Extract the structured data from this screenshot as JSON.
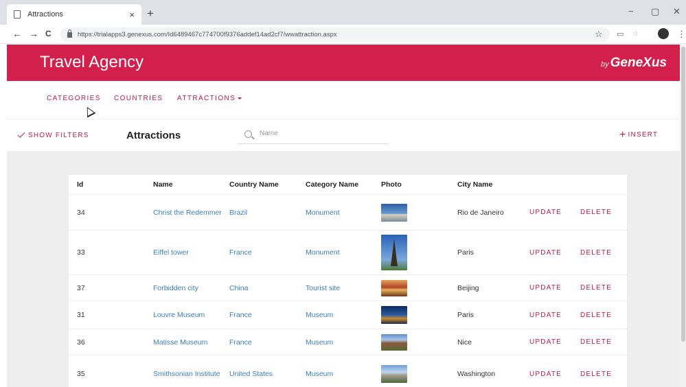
{
  "browser": {
    "tab_title": "Attractions",
    "tab_close": "×",
    "new_tab": "+",
    "back": "←",
    "forward": "→",
    "reload": "C",
    "url": "https://trialapps3.genexus.com/Id6489467c774700f9376addef14ad2cf7/wwattraction.aspx",
    "star": "☆",
    "minimize": "−",
    "restore": "▢",
    "close": "✕",
    "menu": "⋮"
  },
  "header": {
    "title": "Travel Agency",
    "brand_by": "by",
    "brand_name": "GeneXus",
    "color": "#d21f4b"
  },
  "menu": {
    "items": [
      {
        "label": "CATEGORIES"
      },
      {
        "label": "COUNTRIES"
      },
      {
        "label": "ATTRACTIONS"
      }
    ]
  },
  "toolbar": {
    "show_filters": "SHOW FILTERS",
    "page_title": "Attractions",
    "search_placeholder": "Name",
    "insert": "INSERT"
  },
  "table": {
    "columns": [
      "Id",
      "Name",
      "Country Name",
      "Category Name",
      "Photo",
      "City Name"
    ],
    "update_label": "UPDATE",
    "delete_label": "DELETE",
    "rows": [
      {
        "id": "34",
        "name": "Christ the Redemmer",
        "country": "Brazil",
        "category": "Monument",
        "photo": "christ-the-redeemer-photo",
        "city": "Rio de Janeiro"
      },
      {
        "id": "33",
        "name": "Eiffel tower",
        "country": "France",
        "category": "Monument",
        "photo": "eiffel-tower-photo",
        "city": "Paris"
      },
      {
        "id": "37",
        "name": "Forbidden city",
        "country": "China",
        "category": "Tourist site",
        "photo": "forbidden-city-photo",
        "city": "Beijing"
      },
      {
        "id": "31",
        "name": "Louvre Museum",
        "country": "France",
        "category": "Museum",
        "photo": "louvre-museum-photo",
        "city": "Paris"
      },
      {
        "id": "36",
        "name": "Matisse Museum",
        "country": "France",
        "category": "Museum",
        "photo": "matisse-museum-photo",
        "city": "Nice"
      },
      {
        "id": "35",
        "name": "Smithsonian Institute",
        "country": "United States",
        "category": "Museum",
        "photo": "smithsonian-photo",
        "city": "Washington"
      }
    ]
  },
  "colors": {
    "accent": "#c41a44",
    "link": "#3d7fc1",
    "background": "#eeeeee"
  }
}
